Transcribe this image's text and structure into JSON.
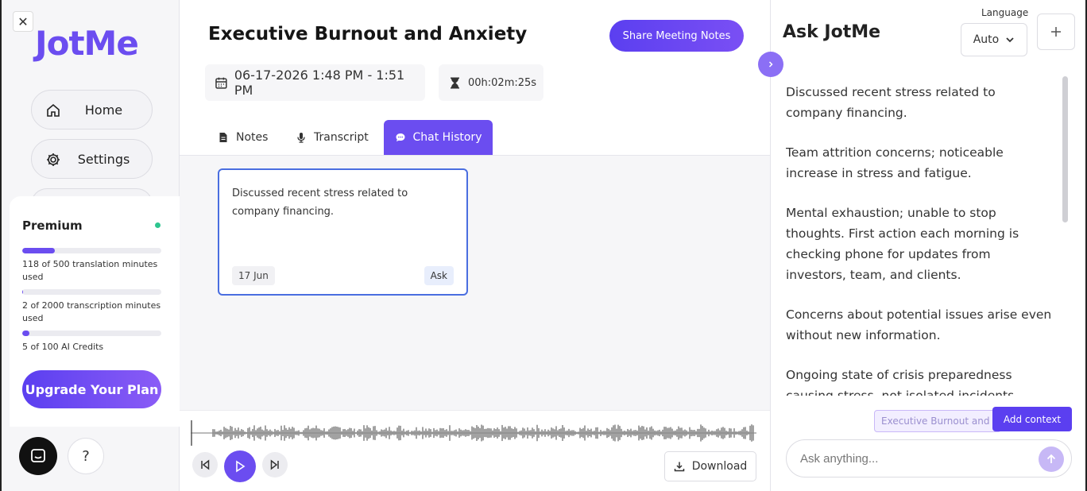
{
  "sidebar": {
    "logo": "JotMe",
    "nav": [
      {
        "label": "Home",
        "icon": "home-icon"
      },
      {
        "label": "Settings",
        "icon": "gear-icon"
      }
    ],
    "premium": {
      "title": "Premium",
      "usage": [
        {
          "text": "118 of 500 translation minutes used",
          "fraction": 0.236
        },
        {
          "text": "2 of 2000 transcription minutes used",
          "fraction": 0.001
        },
        {
          "text": "5 of 100 AI Credits",
          "fraction": 0.05
        }
      ],
      "upgrade_label": "Upgrade Your Plan"
    },
    "help_label": "?"
  },
  "main": {
    "title": "Executive Burnout and Anxiety",
    "share_label": "Share Meeting Notes",
    "date_range": "06-17-2026 1:48 PM - 1:51 PM",
    "duration": "00h:02m:25s",
    "tabs": [
      {
        "label": "Notes",
        "icon": "document-icon"
      },
      {
        "label": "Transcript",
        "icon": "microphone-icon"
      },
      {
        "label": "Chat History",
        "icon": "chat-icon",
        "active": true
      }
    ],
    "card": {
      "text": "Discussed recent stress related to company financing.",
      "date": "17 Jun",
      "ask_label": "Ask"
    },
    "download_label": "Download"
  },
  "right_panel": {
    "title": "Ask JotMe",
    "language_label": "Language",
    "language_value": "Auto",
    "messages": [
      "Discussed recent stress related to company financing.",
      "Team attrition concerns; noticeable increase in stress and fatigue.",
      "Mental exhaustion; unable to stop thoughts. First action each morning is checking phone for updates from investors, team, and clients.",
      "Concerns about potential issues arise even without new information.",
      "Ongoing state of crisis preparedness causing stress, not isolated incidents."
    ],
    "context_chip": "Executive Burnout and Anxiety",
    "add_context_label": "Add context",
    "input_placeholder": "Ask anything..."
  },
  "colors": {
    "accent": "#6b4df0",
    "card_border": "#4a6ee0",
    "status_dot": "#2ec58f"
  }
}
